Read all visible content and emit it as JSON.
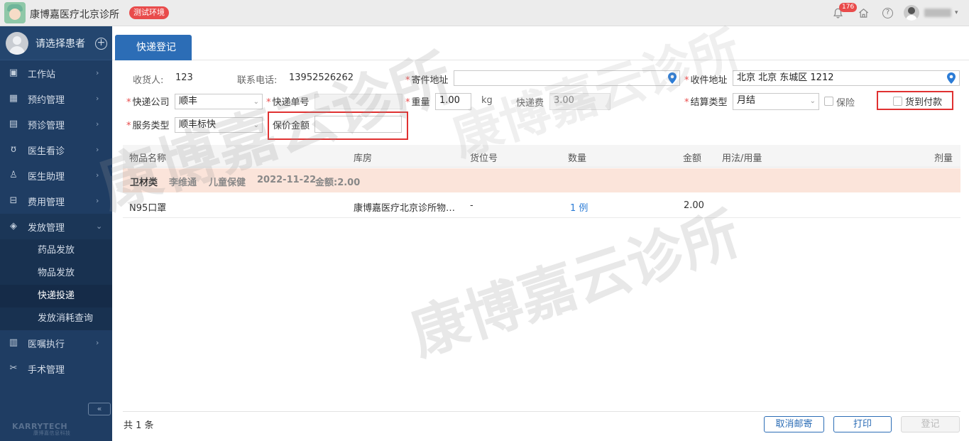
{
  "app": {
    "clinic_name": "康博嘉医疗北京诊所",
    "env_badge": "测试环境",
    "notification_count": "176",
    "help_symbol": "?"
  },
  "sidebar": {
    "patient_select": "请选择患者",
    "add_symbol": "+",
    "items": [
      {
        "label": "工作站",
        "icon": "workstation-icon"
      },
      {
        "label": "预约管理",
        "icon": "calendar-icon"
      },
      {
        "label": "预诊管理",
        "icon": "clipboard-icon"
      },
      {
        "label": "医生看诊",
        "icon": "stethoscope-icon"
      },
      {
        "label": "医生助理",
        "icon": "assistant-icon"
      },
      {
        "label": "费用管理",
        "icon": "billing-icon"
      },
      {
        "label": "发放管理",
        "icon": "pill-icon"
      },
      {
        "label": "医嘱执行",
        "icon": "order-icon"
      },
      {
        "label": "手术管理",
        "icon": "scissors-icon"
      }
    ],
    "sub_items": [
      "药品发放",
      "物品发放",
      "快递投递",
      "发放消耗查询"
    ],
    "collapse_symbol": "«",
    "brand": "KARRYTECH",
    "brand_sub": "康博嘉信息科技"
  },
  "tab": {
    "label": "快递登记"
  },
  "form": {
    "receiver_label": "收货人:",
    "receiver_value": "123",
    "phone_label": "联系电话:",
    "phone_value": "13952526262",
    "sender_address_label": "寄件地址",
    "sender_address_value": "",
    "receiver_address_label": "收件地址",
    "receiver_address_value": "北京 北京 东城区 1212",
    "courier_label": "快递公司",
    "courier_value": "顺丰",
    "tracking_label": "快递单号",
    "tracking_value": "",
    "weight_label": "重量",
    "weight_value": "1.00",
    "weight_unit": "kg",
    "fee_label": "快递费",
    "fee_value": "3.00",
    "settlement_label": "结算类型",
    "settlement_value": "月结",
    "insurance_label": "保险",
    "cod_label": "货到付款",
    "service_label": "服务类型",
    "service_value": "顺丰标快",
    "insured_amount_label": "保价金额",
    "insured_amount_value": ""
  },
  "table": {
    "headers": [
      "物品名称",
      "库房",
      "货位号",
      "数量",
      "金额",
      "用法/用量",
      "剂量"
    ],
    "group": {
      "category": "卫材类",
      "doctor": "李维通",
      "department": "儿童保健",
      "date": "2022-11-22",
      "amount": "金额:2.00"
    },
    "rows": [
      {
        "name": "N95口罩",
        "warehouse": "康博嘉医疗北京诊所物…",
        "location": "-",
        "quantity": "1 例",
        "amount": "2.00",
        "usage": "",
        "dose": ""
      }
    ]
  },
  "footer": {
    "total": "共 1 条",
    "cancel_label": "取消邮寄",
    "print_label": "打印",
    "register_label": "登记"
  },
  "watermark": {
    "text1": "康博嘉云诊所",
    "text2": "康博嘉云诊所",
    "text3": "康博嘉云诊所"
  }
}
